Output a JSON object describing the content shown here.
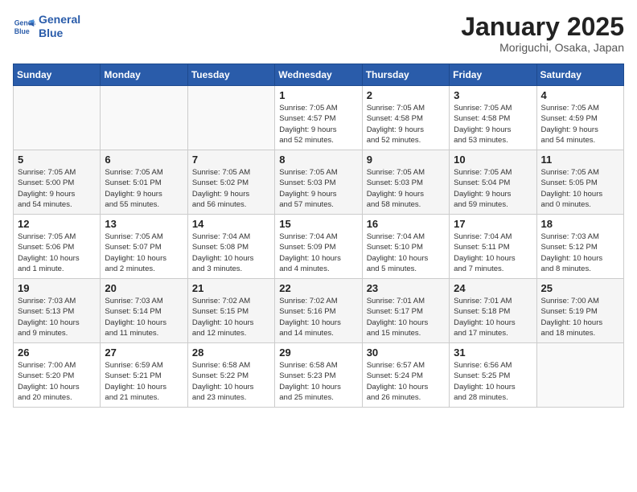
{
  "header": {
    "logo_line1": "General",
    "logo_line2": "Blue",
    "month": "January 2025",
    "location": "Moriguchi, Osaka, Japan"
  },
  "weekdays": [
    "Sunday",
    "Monday",
    "Tuesday",
    "Wednesday",
    "Thursday",
    "Friday",
    "Saturday"
  ],
  "weeks": [
    [
      {
        "day": "",
        "info": ""
      },
      {
        "day": "",
        "info": ""
      },
      {
        "day": "",
        "info": ""
      },
      {
        "day": "1",
        "info": "Sunrise: 7:05 AM\nSunset: 4:57 PM\nDaylight: 9 hours\nand 52 minutes."
      },
      {
        "day": "2",
        "info": "Sunrise: 7:05 AM\nSunset: 4:58 PM\nDaylight: 9 hours\nand 52 minutes."
      },
      {
        "day": "3",
        "info": "Sunrise: 7:05 AM\nSunset: 4:58 PM\nDaylight: 9 hours\nand 53 minutes."
      },
      {
        "day": "4",
        "info": "Sunrise: 7:05 AM\nSunset: 4:59 PM\nDaylight: 9 hours\nand 54 minutes."
      }
    ],
    [
      {
        "day": "5",
        "info": "Sunrise: 7:05 AM\nSunset: 5:00 PM\nDaylight: 9 hours\nand 54 minutes."
      },
      {
        "day": "6",
        "info": "Sunrise: 7:05 AM\nSunset: 5:01 PM\nDaylight: 9 hours\nand 55 minutes."
      },
      {
        "day": "7",
        "info": "Sunrise: 7:05 AM\nSunset: 5:02 PM\nDaylight: 9 hours\nand 56 minutes."
      },
      {
        "day": "8",
        "info": "Sunrise: 7:05 AM\nSunset: 5:03 PM\nDaylight: 9 hours\nand 57 minutes."
      },
      {
        "day": "9",
        "info": "Sunrise: 7:05 AM\nSunset: 5:03 PM\nDaylight: 9 hours\nand 58 minutes."
      },
      {
        "day": "10",
        "info": "Sunrise: 7:05 AM\nSunset: 5:04 PM\nDaylight: 9 hours\nand 59 minutes."
      },
      {
        "day": "11",
        "info": "Sunrise: 7:05 AM\nSunset: 5:05 PM\nDaylight: 10 hours\nand 0 minutes."
      }
    ],
    [
      {
        "day": "12",
        "info": "Sunrise: 7:05 AM\nSunset: 5:06 PM\nDaylight: 10 hours\nand 1 minute."
      },
      {
        "day": "13",
        "info": "Sunrise: 7:05 AM\nSunset: 5:07 PM\nDaylight: 10 hours\nand 2 minutes."
      },
      {
        "day": "14",
        "info": "Sunrise: 7:04 AM\nSunset: 5:08 PM\nDaylight: 10 hours\nand 3 minutes."
      },
      {
        "day": "15",
        "info": "Sunrise: 7:04 AM\nSunset: 5:09 PM\nDaylight: 10 hours\nand 4 minutes."
      },
      {
        "day": "16",
        "info": "Sunrise: 7:04 AM\nSunset: 5:10 PM\nDaylight: 10 hours\nand 5 minutes."
      },
      {
        "day": "17",
        "info": "Sunrise: 7:04 AM\nSunset: 5:11 PM\nDaylight: 10 hours\nand 7 minutes."
      },
      {
        "day": "18",
        "info": "Sunrise: 7:03 AM\nSunset: 5:12 PM\nDaylight: 10 hours\nand 8 minutes."
      }
    ],
    [
      {
        "day": "19",
        "info": "Sunrise: 7:03 AM\nSunset: 5:13 PM\nDaylight: 10 hours\nand 9 minutes."
      },
      {
        "day": "20",
        "info": "Sunrise: 7:03 AM\nSunset: 5:14 PM\nDaylight: 10 hours\nand 11 minutes."
      },
      {
        "day": "21",
        "info": "Sunrise: 7:02 AM\nSunset: 5:15 PM\nDaylight: 10 hours\nand 12 minutes."
      },
      {
        "day": "22",
        "info": "Sunrise: 7:02 AM\nSunset: 5:16 PM\nDaylight: 10 hours\nand 14 minutes."
      },
      {
        "day": "23",
        "info": "Sunrise: 7:01 AM\nSunset: 5:17 PM\nDaylight: 10 hours\nand 15 minutes."
      },
      {
        "day": "24",
        "info": "Sunrise: 7:01 AM\nSunset: 5:18 PM\nDaylight: 10 hours\nand 17 minutes."
      },
      {
        "day": "25",
        "info": "Sunrise: 7:00 AM\nSunset: 5:19 PM\nDaylight: 10 hours\nand 18 minutes."
      }
    ],
    [
      {
        "day": "26",
        "info": "Sunrise: 7:00 AM\nSunset: 5:20 PM\nDaylight: 10 hours\nand 20 minutes."
      },
      {
        "day": "27",
        "info": "Sunrise: 6:59 AM\nSunset: 5:21 PM\nDaylight: 10 hours\nand 21 minutes."
      },
      {
        "day": "28",
        "info": "Sunrise: 6:58 AM\nSunset: 5:22 PM\nDaylight: 10 hours\nand 23 minutes."
      },
      {
        "day": "29",
        "info": "Sunrise: 6:58 AM\nSunset: 5:23 PM\nDaylight: 10 hours\nand 25 minutes."
      },
      {
        "day": "30",
        "info": "Sunrise: 6:57 AM\nSunset: 5:24 PM\nDaylight: 10 hours\nand 26 minutes."
      },
      {
        "day": "31",
        "info": "Sunrise: 6:56 AM\nSunset: 5:25 PM\nDaylight: 10 hours\nand 28 minutes."
      },
      {
        "day": "",
        "info": ""
      }
    ]
  ]
}
